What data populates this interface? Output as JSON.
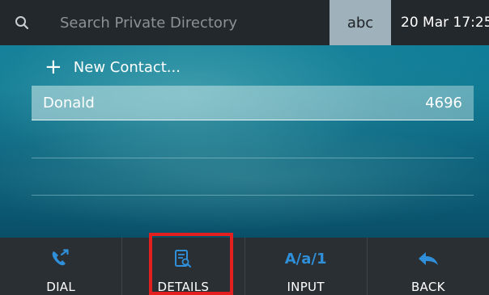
{
  "header": {
    "search_icon": "search-icon",
    "search_placeholder": "Search Private Directory",
    "input_mode": "abc",
    "datetime": "20 Mar 17:25"
  },
  "directory": {
    "new_contact_label": "New Contact...",
    "contacts": [
      {
        "name": "Donald",
        "number": "4696"
      }
    ]
  },
  "softkeys": [
    {
      "label": "DIAL",
      "icon": "phone-call-icon"
    },
    {
      "label": "DETAILS",
      "icon": "contact-details-icon"
    },
    {
      "label": "INPUT",
      "icon": "input-mode-icon",
      "icon_text": "A/a/1"
    },
    {
      "label": "BACK",
      "icon": "back-arrow-icon"
    }
  ],
  "colors": {
    "accent_blue": "#2f8fd8",
    "highlight_red": "#e41f1f",
    "bar_dark": "#23282c",
    "mode_bg": "#9fb2bc"
  }
}
